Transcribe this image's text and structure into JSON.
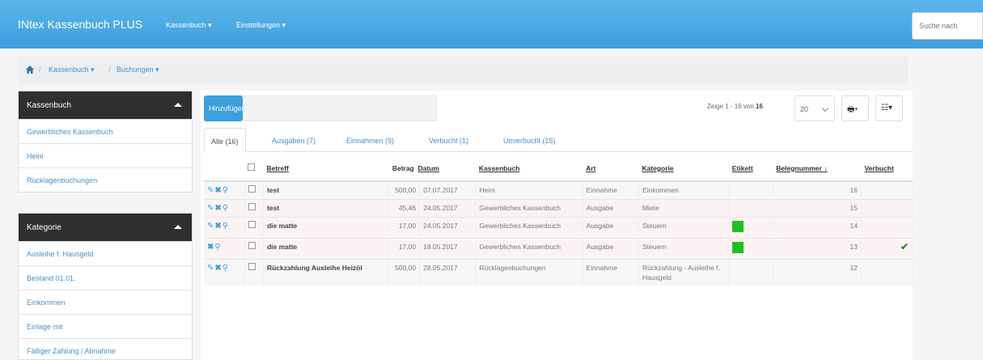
{
  "navbar": {
    "brand": "INtex Kassenbuch PLUS",
    "menu": [
      "Kassenbuch ▾",
      "Einstellungen ▾"
    ],
    "search_placeholder": "Suche nach"
  },
  "breadcrumb": {
    "items": [
      "Kassenbuch ▾",
      "Buchungen ▾"
    ]
  },
  "sidebar": {
    "kassenbuch": {
      "title": "Kassenbuch",
      "items": [
        "Gewerbliches Kassenbuch",
        "Heini",
        "Rücklagenbuchungen"
      ]
    },
    "kategorie": {
      "title": "Kategorie",
      "items": [
        "Ausleihe f. Hausgeld",
        "Bestand 01.01.",
        "Einkommen",
        "Einlage mit",
        "Fälliger Zahlung / Abnahme"
      ]
    }
  },
  "toolbar": {
    "add_label": "Hinzufügen",
    "pager_prefix": "Zeige 1 - 16 von",
    "pager_total": "16",
    "per_page": "20",
    "print_label": "🖶▾",
    "columns_label": "☷▾"
  },
  "tabs": [
    "Alle (16)",
    "Ausgaben (7)",
    "Einnahmen (9)",
    "Verbucht (1)",
    "Unverbucht (15)"
  ],
  "table": {
    "headers": {
      "betreff": "Betreff",
      "betrag": "Betrag",
      "datum": "Datum",
      "kassenbuch": "Kassenbuch",
      "art": "Art",
      "kategorie": "Kategorie",
      "etikett": "Etikett",
      "belegnummer": "Belegnummer ↓",
      "verbucht": "Verbucht"
    },
    "rows": [
      {
        "betreff": "test",
        "betrag": "500,00",
        "datum": "07.07.2017",
        "kassenbuch": "Heini",
        "art": "Einnahme",
        "kategorie": "Einkommen",
        "belegnummer": "16"
      },
      {
        "betreff": "test",
        "betrag": "45,46",
        "datum": "24.05.2017",
        "kassenbuch": "Gewerbliches Kassenbuch",
        "art": "Ausgabe",
        "kategorie": "Miete",
        "belegnummer": "15"
      },
      {
        "betreff": "die matte",
        "betrag": "17,00",
        "datum": "24.05.2017",
        "kassenbuch": "Gewerbliches Kassenbuch",
        "art": "Ausgabe",
        "kategorie": "Steuern",
        "belegnummer": "14"
      },
      {
        "betreff": "die matte",
        "betrag": "17,00",
        "datum": "19.05.2017",
        "kassenbuch": "Gewerbliches Kassenbuch",
        "art": "Ausgabe",
        "kategorie": "Steuern",
        "belegnummer": "13"
      },
      {
        "betreff": "Rückzahlung Ausleihe Heizöl",
        "betrag": "500,00",
        "datum": "28.05.2017",
        "kassenbuch": "Rücklagenbuchungen",
        "art": "Einnahme",
        "kategorie": "Rückzahlung - Ausleihe f. Hausgeld",
        "belegnummer": "12"
      }
    ]
  },
  "colors": {
    "nav": "#3d9fdc",
    "etikett_green": "#1ec21e",
    "sidebar_head": "#2f2f2f"
  }
}
